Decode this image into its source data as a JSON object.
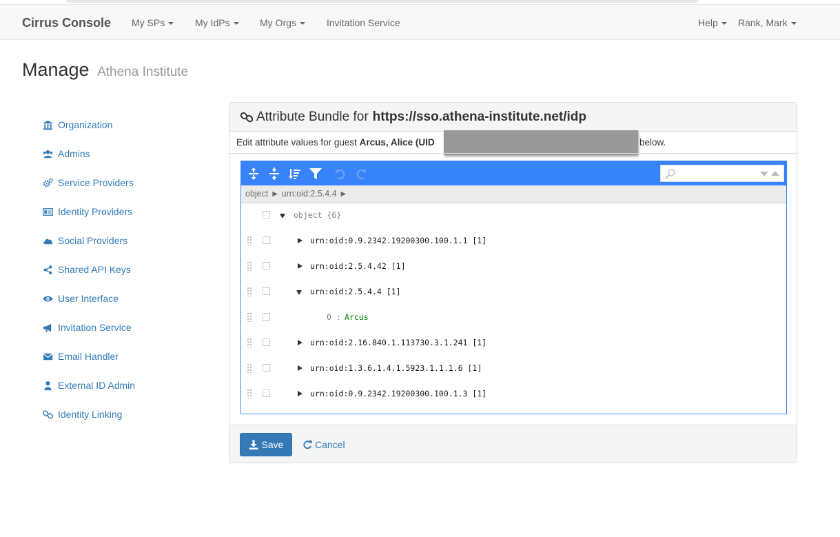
{
  "navbar": {
    "brand": "Cirrus Console",
    "items": [
      "My SPs",
      "My IdPs",
      "My Orgs",
      "Invitation Service"
    ],
    "right_items": [
      "Help",
      "Rank, Mark"
    ]
  },
  "page": {
    "title": "Manage",
    "subtitle": "Athena Institute"
  },
  "sidebar": {
    "items": [
      {
        "label": "Organization",
        "icon": "bank-icon"
      },
      {
        "label": "Admins",
        "icon": "users-icon"
      },
      {
        "label": "Service Providers",
        "icon": "cogs-icon"
      },
      {
        "label": "Identity Providers",
        "icon": "id-card-icon"
      },
      {
        "label": "Social Providers",
        "icon": "cloud-icon"
      },
      {
        "label": "Shared API Keys",
        "icon": "share-icon"
      },
      {
        "label": "User Interface",
        "icon": "eye-icon"
      },
      {
        "label": "Invitation Service",
        "icon": "bullhorn-icon"
      },
      {
        "label": "Email Handler",
        "icon": "envelope-icon"
      },
      {
        "label": "External ID Admin",
        "icon": "user-icon"
      },
      {
        "label": "Identity Linking",
        "icon": "link-icon"
      }
    ]
  },
  "panel": {
    "title_prefix": "Attribute Bundle for",
    "title_url": "https://sso.athena-institute.net/idp",
    "desc_prefix": "Edit attribute values for guest",
    "guest_name": "Arcus, Alice (UID",
    "desc_suffix": "below."
  },
  "editor": {
    "breadcrumb": "object ► urn:oid:2.5.4.4 ►",
    "nodes": [
      {
        "key": "object",
        "meta": "{6}",
        "expanded": true,
        "level": 0
      },
      {
        "key": "urn:oid:0.9.2342.19200300.100.1.1",
        "meta": "[1]",
        "expanded": false,
        "level": 1
      },
      {
        "key": "urn:oid:2.5.4.42",
        "meta": "[1]",
        "expanded": false,
        "level": 1
      },
      {
        "key": "urn:oid:2.5.4.4",
        "meta": "[1]",
        "expanded": true,
        "level": 1
      },
      {
        "index": "0",
        "sep": ":",
        "value": "Arcus",
        "level": 2
      },
      {
        "key": "urn:oid:2.16.840.1.113730.3.1.241",
        "meta": "[1]",
        "expanded": false,
        "level": 1
      },
      {
        "key": "urn:oid:1.3.6.1.4.1.5923.1.1.1.6",
        "meta": "[1]",
        "expanded": false,
        "level": 1
      },
      {
        "key": "urn:oid:0.9.2342.19200300.100.1.3",
        "meta": "[1]",
        "expanded": false,
        "level": 1
      }
    ]
  },
  "footer": {
    "save_label": "Save",
    "cancel_label": "Cancel"
  },
  "colors": {
    "accent": "#337ab7",
    "editor_menu": "#3883fa",
    "value_green": "#008000"
  }
}
